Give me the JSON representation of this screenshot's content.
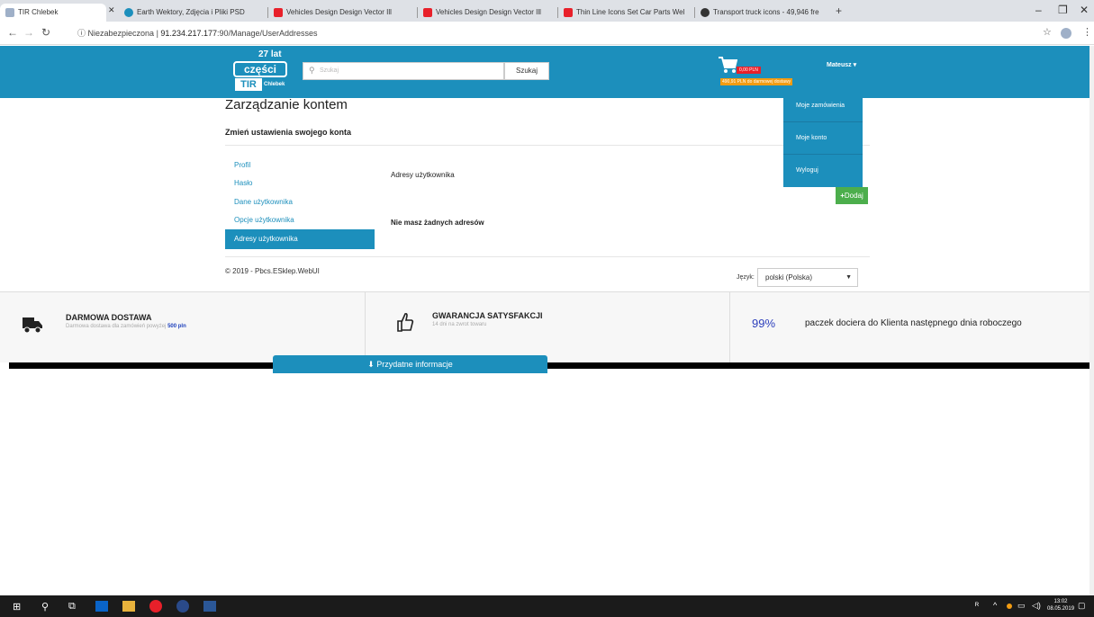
{
  "browser": {
    "tabs": [
      {
        "title": "TIR Chlebek",
        "favicon_color": "#9fb0c8"
      },
      {
        "title": "Earth Wektory, Zdjęcia i Pliki PSD",
        "favicon_color": "#1c8fbc"
      },
      {
        "title": "Vehicles Design Design Vector Ill",
        "favicon_color": "#e8202a"
      },
      {
        "title": "Vehicles Design Design Vector Ill",
        "favicon_color": "#e8202a"
      },
      {
        "title": "Thin Line Icons Set Car Parts Wel",
        "favicon_color": "#e8202a"
      },
      {
        "title": "Transport truck icons - 49,946 fre",
        "favicon_color": "#333333"
      }
    ],
    "new_tab": "+",
    "url_prefix": "Niezabezpieczona",
    "url_host": "91.234.217.177",
    "url_path": ":90/Manage/UserAddresses"
  },
  "header": {
    "years": "27 lat",
    "logo_czesci": "części",
    "logo_tir": "TIR",
    "logo_chlebek": "Chlebek",
    "search_placeholder": "Szukaj",
    "search_button": "Szukaj",
    "cart_price": "0,00 PLN",
    "free_delivery": "490,91 PLN do darmowej dostawy",
    "user_name": "Mateusz"
  },
  "dropdown": [
    "Moje zamówienia",
    "Moje konto",
    "Wyloguj"
  ],
  "page": {
    "title": "Zarządzanie kontem",
    "subtitle": "Zmień ustawienia swojego konta",
    "sidebar": [
      "Profil",
      "Hasło",
      "Dane użytkownika",
      "Opcje użytkownika",
      "Adresy użytkownika"
    ],
    "active_index": 4,
    "content_title": "Adresy użytkownika",
    "add_button": "Dodaj",
    "empty_message": "Nie masz żadnych adresów",
    "copyright": "© 2019 - Pbcs.ESklep.WebUI",
    "language_label": "Język:",
    "language_value": "polski (Polska)"
  },
  "features": {
    "delivery_title": "DARMOWA DOSTAWA",
    "delivery_sub": "Darmowa dostawa dla zamówień powyżej",
    "delivery_amount": "500 pln",
    "guarantee_title": "GWARANCJA SATYSFAKCJI",
    "guarantee_sub": "14 dni na zwrot towaru",
    "percent": "99%",
    "percent_text": "paczek dociera do Klienta następnego dnia roboczego",
    "info_button": "Przydatne informacje"
  },
  "taskbar": {
    "time": "13:02",
    "date": "08.05.2019"
  },
  "colors": {
    "brand": "#1c8fbc",
    "add_green": "#4cae4c",
    "cart_red": "#e8202a",
    "orange": "#f39c12"
  }
}
